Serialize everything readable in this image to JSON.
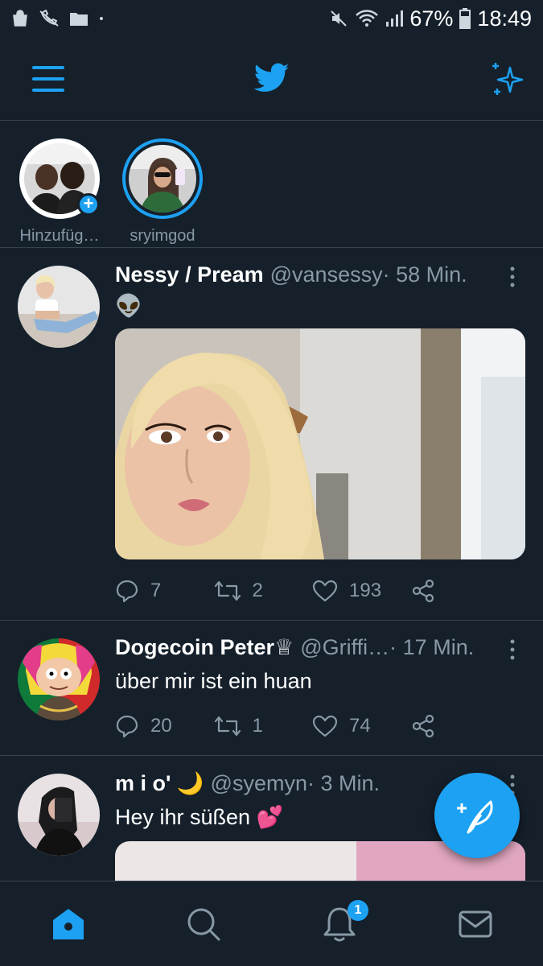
{
  "status_bar": {
    "battery": "67%",
    "time": "18:49",
    "icons": [
      "bag-icon",
      "phone-off-icon",
      "folder-icon",
      "dot-icon",
      "mute-icon",
      "wifi-icon",
      "signal-icon",
      "battery-icon"
    ]
  },
  "header": {
    "icons": [
      "menu-icon",
      "twitter-bird-icon",
      "sparkle-icon"
    ]
  },
  "fleets": [
    {
      "label": "Hinzufüg…",
      "icon": "plus-icon"
    },
    {
      "label": "sryimgod"
    }
  ],
  "tweets": [
    {
      "display_name": "Nessy / Pream",
      "handle": "@vansessy",
      "time": " · 58 Min.",
      "text": "👽",
      "replies": "7",
      "retweets": "2",
      "likes": "193",
      "has_media": true
    },
    {
      "display_name": "Dogecoin Peter♕",
      "handle": "@Griffi…",
      "time": " · 17 Min.",
      "text": "über mir ist ein huan",
      "replies": "20",
      "retweets": "1",
      "likes": "74",
      "has_media": false
    },
    {
      "display_name": "m i o' 🌙",
      "handle": "@syemyn",
      "time": " · 3 Min.",
      "text": "Hey ihr süßen 💕",
      "has_media": true
    }
  ],
  "bottom_nav": {
    "items": [
      "home-icon",
      "search-icon",
      "notifications-icon",
      "messages-icon"
    ],
    "notification_count": "1"
  },
  "colors": {
    "background": "#15202b",
    "accent": "#1da1f2",
    "muted": "#8899a6",
    "divider": "#38444d"
  }
}
